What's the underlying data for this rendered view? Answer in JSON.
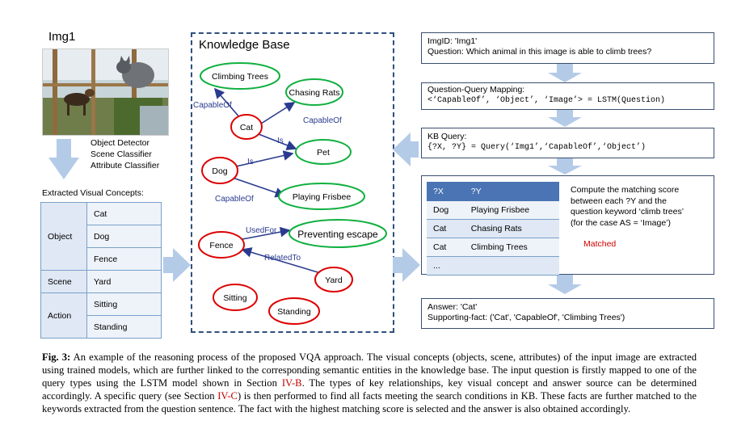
{
  "image": {
    "label": "Img1",
    "classifiers": [
      "Object Detector",
      "Scene Classifier",
      "Attribute Classifier"
    ]
  },
  "visual_concepts": {
    "title": "Extracted Visual Concepts:",
    "groups": [
      {
        "category": "Object",
        "values": [
          "Cat",
          "Dog",
          "Fence"
        ]
      },
      {
        "category": "Scene",
        "values": [
          "Yard"
        ]
      },
      {
        "category": "Action",
        "values": [
          "Sitting",
          "Standing"
        ]
      }
    ]
  },
  "knowledge_base": {
    "title": "Knowledge Base",
    "nodes": {
      "climbing_trees": "Climbing Trees",
      "chasing_rats": "Chasing Rats",
      "cat": "Cat",
      "pet": "Pet",
      "dog": "Dog",
      "playing_frisbee": "Playing Frisbee",
      "fence": "Fence",
      "preventing_escape": "Preventing escape",
      "yard": "Yard",
      "sitting": "Sitting",
      "standing": "Standing"
    },
    "edges": {
      "capableof_1": "CapableOf",
      "capableof_2": "CapableOf",
      "is_1": "Is",
      "is_2": "Is",
      "capableof_3": "CapableOf",
      "usedfor": "UsedFor",
      "relatedto": "RelatedTo"
    }
  },
  "pipeline": {
    "query_box": {
      "line1": "ImgID: 'Img1'",
      "line2": "Question: Which animal in this image is able to climb trees?"
    },
    "mapping_box": {
      "line1": "Question-Query Mapping:",
      "line2": "<‘CapableOf’, ‘Object’, ‘Image’> = LSTM(Question)"
    },
    "kb_query_box": {
      "line1": "KB Query:",
      "line2": "{?X, ?Y} = Query(‘Img1’,‘CapableOf’,‘Object’)"
    },
    "match_table": {
      "headers": [
        "?X",
        "?Y"
      ],
      "rows": [
        [
          "Dog",
          "Playing Frisbee"
        ],
        [
          "Cat",
          "Chasing Rats"
        ],
        [
          "Cat",
          "Climbing Trees"
        ],
        [
          "...",
          ""
        ]
      ]
    },
    "compute_text": [
      "Compute the matching score",
      "between each ?Y and the",
      "question keyword ‘climb trees’",
      "(for the case AS = ‘Image’)"
    ],
    "matched_label": "Matched",
    "answer_box": {
      "line1": "Answer: 'Cat'",
      "line2": "Supporting-fact: ('Cat', 'CapableOf', 'Climbing Trees')"
    }
  },
  "caption": {
    "label": "Fig. 3:",
    "part1": " An example of the reasoning process of the proposed VQA approach. The visual concepts (objects, scene, attributes) of the input image are extracted using trained models, which are further linked to the corresponding semantic entities in the knowledge base. The input question is firstly mapped to one of the query types using the LSTM model shown in Section ",
    "ref1": "IV-B",
    "part2": ". The types of key relationships, key visual concept and answer source can be determined accordingly. A specific query (see Section ",
    "ref2": "IV-C",
    "part3": ") is then performed to find all facts meeting the search conditions in KB. These facts are further matched to the keywords extracted from the question sentence. The fact with the highest matching score is selected and the answer is also obtained accordingly."
  },
  "colors": {
    "arrow_fill": "#b4cbe8",
    "kb_border": "#2f4f7f",
    "red_node": "#dd0000",
    "green_node": "#10b040",
    "edge_color": "#2a3b8f",
    "header_blue": "#4a74b4"
  }
}
